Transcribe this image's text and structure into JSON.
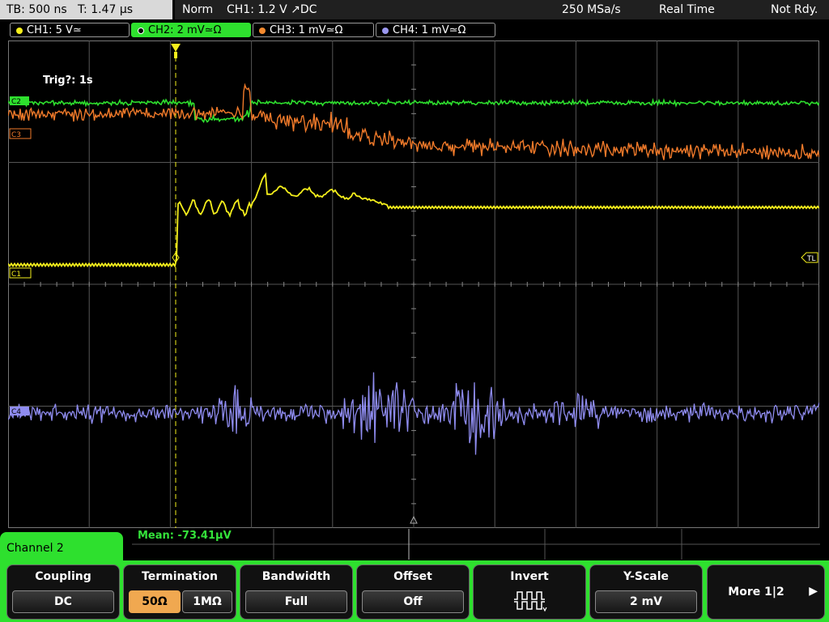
{
  "status": {
    "timebase": "TB: 500 ns   T: 1.47 µs",
    "mode": "Norm",
    "trigger": "CH1: 1.2 V ↗DC",
    "sample_rate": "250 MSa/s",
    "acq_mode": "Real Time",
    "ready": "Not Rdy."
  },
  "channels": [
    {
      "label": "CH1: 5 V≃",
      "color": "#f5ef1c"
    },
    {
      "label": "CH2: 2 mV≃Ω",
      "color": "#2ee02e"
    },
    {
      "label": "CH3: 1 mV≃Ω",
      "color": "#f58a2e"
    },
    {
      "label": "CH4: 1 mV≃Ω",
      "color": "#9b98f0"
    }
  ],
  "markers": {
    "c2": "C2",
    "c3": "C3",
    "c1": "C1",
    "c4": "C4",
    "tl": "TL"
  },
  "trigger_note": "Trig?: 1s",
  "measurement": "Mean: -73.41µV",
  "menu_title": "Channel 2",
  "softkeys": {
    "coupling": {
      "label": "Coupling",
      "value": "DC"
    },
    "termination": {
      "label": "Termination",
      "options": [
        "50Ω",
        "1MΩ"
      ],
      "selected": "50Ω"
    },
    "bandwidth": {
      "label": "Bandwidth",
      "value": "Full"
    },
    "offset": {
      "label": "Offset",
      "value": "Off"
    },
    "invert": {
      "label": "Invert"
    },
    "yscale": {
      "label": "Y-Scale",
      "value": "2 mV"
    },
    "more": {
      "label": "More 1|2"
    }
  },
  "colors": {
    "ch1": "#f5ef1c",
    "ch2": "#2ee02e",
    "ch3": "#f07a2a",
    "ch4": "#8f8cf0",
    "grid": "#5a5a5a"
  }
}
